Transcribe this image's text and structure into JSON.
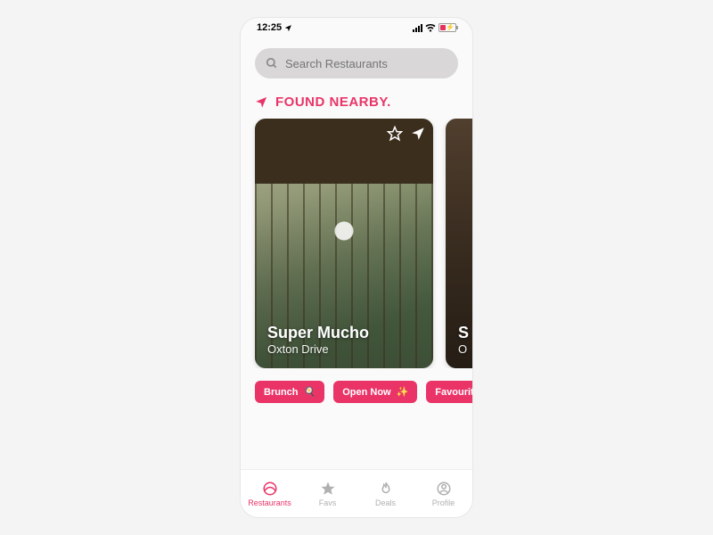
{
  "status": {
    "time": "12:25"
  },
  "search": {
    "placeholder": "Search Restaurants"
  },
  "section": {
    "heading": "FOUND NEARBY."
  },
  "cards": [
    {
      "title": "Super Mucho",
      "subtitle": "Oxton Drive"
    },
    {
      "title": "S",
      "subtitle": "O"
    }
  ],
  "chips": [
    {
      "label": "Brunch"
    },
    {
      "label": "Open Now"
    },
    {
      "label": "Favourite F"
    }
  ],
  "tabs": [
    {
      "label": "Restaurants"
    },
    {
      "label": "Favs"
    },
    {
      "label": "Deals"
    },
    {
      "label": "Profile"
    }
  ]
}
